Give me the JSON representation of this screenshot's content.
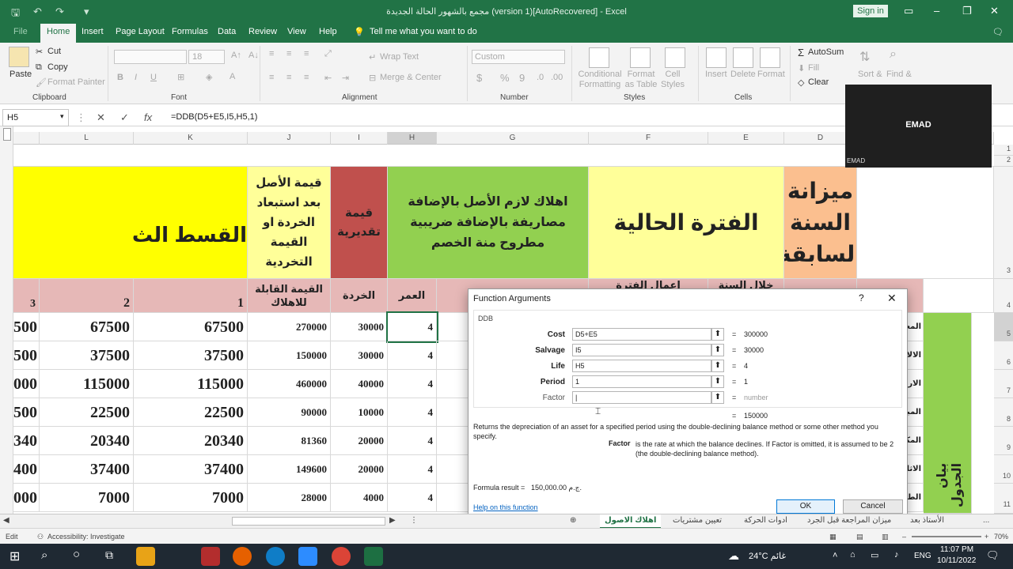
{
  "window": {
    "title": "مجمع بالشهور الحالة الجديدة (version 1)[AutoRecovered]  -  Excel",
    "signin": "Sign in"
  },
  "ribbon_tabs": [
    "File",
    "Home",
    "Insert",
    "Page Layout",
    "Formulas",
    "Data",
    "Review",
    "View",
    "Help"
  ],
  "tell_me": "Tell me what you want to do",
  "ribbon": {
    "clipboard": {
      "label": "Clipboard",
      "paste": "Paste",
      "cut": "Cut",
      "copy": "Copy",
      "format_painter": "Format Painter"
    },
    "font": {
      "label": "Font",
      "size": "18",
      "bold": "B",
      "italic": "I",
      "underline": "U"
    },
    "alignment": {
      "label": "Alignment",
      "wrap_text": "Wrap Text",
      "merge_center": "Merge & Center"
    },
    "number": {
      "label": "Number",
      "format": "Custom",
      "currency": "$",
      "percent": "%",
      "comma": "9"
    },
    "styles": {
      "label": "Styles",
      "conditional": "Conditional Formatting",
      "format_table": "Format as Table",
      "cell_styles": "Cell Styles"
    },
    "cells": {
      "label": "Cells",
      "insert": "Insert",
      "delete": "Delete",
      "format": "Format"
    },
    "editing": {
      "autosum": "AutoSum",
      "fill": "Fill",
      "clear": "Clear",
      "sort": "Sort &",
      "find": "Find &"
    }
  },
  "formula_bar": {
    "name_box": "H5",
    "formula": "=DDB(D5+E5,I5,H5,1)"
  },
  "columns": [
    "L",
    "K",
    "J",
    "I",
    "H",
    "G",
    "F",
    "E",
    "D"
  ],
  "rows": [
    "1",
    "2",
    "3",
    "4",
    "5",
    "6",
    "7",
    "8",
    "9",
    "10",
    "11"
  ],
  "sheet_headers": {
    "installment": "القسط الث",
    "asset_value": "قيمة الأصل بعد استبعاد الخردة او القيمة التخردية",
    "estimated": "قيمة تقديرية",
    "required_dep": "اهلاك لازم الأصل بالإضافة مصاريفة بالإضافة ضريبية مطروح منة الخصم",
    "current_period": "الفترة الحالية",
    "prev_year": "ميزانة السنة السابقة",
    "depreciable": "القيمة القابلة للاهلاك",
    "scrap": "الخردة",
    "life": "العمر",
    "col3": "3",
    "col2": "2",
    "col1": "1",
    "partial_f": "اعمال الفترة",
    "partial_e": "خلال السنة",
    "side_a": "الا",
    "side_vertical": "بيان الجدول"
  },
  "table_rows": [
    {
      "c3": "500",
      "c2": "67500",
      "c1": "67500",
      "dep": "270000",
      "scrap": "30000",
      "life": "4",
      "side": "المعد"
    },
    {
      "c3": "500",
      "c2": "37500",
      "c1": "37500",
      "dep": "150000",
      "scrap": "30000",
      "life": "4",
      "side": "الالا"
    },
    {
      "c3": "000",
      "c2": "115000",
      "c1": "115000",
      "dep": "460000",
      "scrap": "40000",
      "life": "4",
      "side": "الارا"
    },
    {
      "c3": "500",
      "c2": "22500",
      "c1": "22500",
      "dep": "90000",
      "scrap": "10000",
      "life": "4",
      "side": "المبا"
    },
    {
      "c3": "340",
      "c2": "20340",
      "c1": "20340",
      "dep": "81360",
      "scrap": "20000",
      "life": "4",
      "side": "المكا"
    },
    {
      "c3": "400",
      "c2": "37400",
      "c1": "37400",
      "dep": "149600",
      "scrap": "20000",
      "life": "4",
      "side": "الاثا"
    },
    {
      "c3": "000",
      "c2": "7000",
      "c1": "7000",
      "dep": "28000",
      "scrap": "4000",
      "life": "4",
      "side": "الطا"
    }
  ],
  "dialog": {
    "title": "Function Arguments",
    "help_q": "?",
    "close": "✕",
    "func": "DDB",
    "args": [
      {
        "label": "Cost",
        "value": "D5+E5",
        "result": "300000"
      },
      {
        "label": "Salvage",
        "value": "I5",
        "result": "30000"
      },
      {
        "label": "Life",
        "value": "H5",
        "result": "4"
      },
      {
        "label": "Period",
        "value": "1",
        "result": "1"
      },
      {
        "label": "Factor",
        "value": "|",
        "result": "number"
      }
    ],
    "total": "150000",
    "description": "Returns the depreciation of an asset for a specified period using the double-declining balance method or some other method you specify.",
    "factor_label": "Factor",
    "factor_desc": "is the rate at which the balance declines. If Factor is omitted, it is assumed to be 2 (the double-declining balance method).",
    "formula_result_label": "Formula result =",
    "formula_result_value": "150,000.00 ج.م.",
    "help_link": "Help on this function",
    "ok": "OK",
    "cancel": "Cancel"
  },
  "sheet_tabs": [
    "...",
    "الأستاذ بعد",
    "ميزان المراجعة قبل الجرد",
    "ادوات الحركة",
    "تعيين مشتريات",
    "اهلاك الاصول"
  ],
  "status": {
    "mode": "Edit",
    "accessibility": "Accessibility: Investigate",
    "zoom": "70%"
  },
  "taskbar": {
    "weather": "24°C  غائم",
    "lang": "ENG",
    "time": "11:07 PM",
    "date": "10/11/2022"
  },
  "webcam": {
    "name": "EMAD",
    "small": "EMAD"
  },
  "colors": {
    "excel_green": "#217346",
    "yellow": "#ffff00",
    "light_yellow": "#ffff99",
    "red": "#c0504d",
    "green": "#92d050",
    "orange": "#fbbf8f",
    "pink": "#e6b8b7"
  }
}
